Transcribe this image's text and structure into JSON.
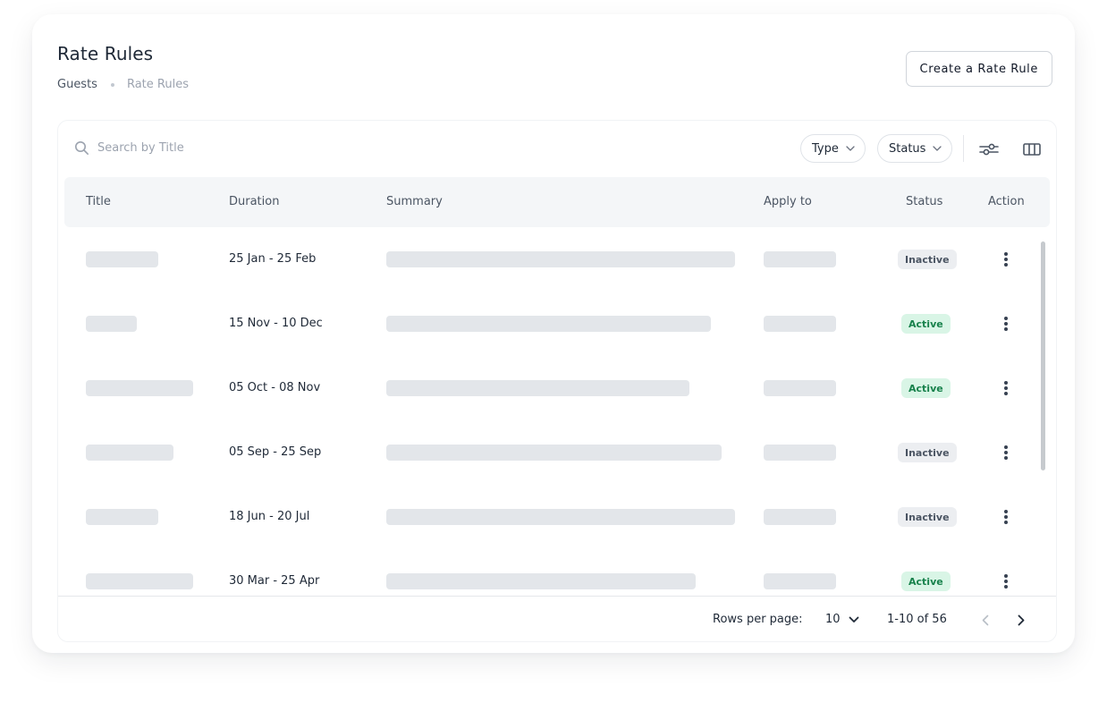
{
  "header": {
    "title": "Rate Rules",
    "breadcrumb": [
      "Guests",
      "Rate Rules"
    ],
    "create_button_label": "Create a Rate Rule"
  },
  "toolbar": {
    "search_placeholder": "Search by Title",
    "search_icon": "search-icon",
    "filters": [
      {
        "label": "Type",
        "icon": "chevron-down-icon"
      },
      {
        "label": "Status",
        "icon": "chevron-down-icon"
      }
    ],
    "tools": [
      "sliders-icon",
      "columns-icon"
    ]
  },
  "table": {
    "columns": [
      "Title",
      "Duration",
      "Summary",
      "Apply to",
      "Status",
      "Action"
    ],
    "rows": [
      {
        "duration": "25 Jan - 25 Feb",
        "status": "Inactive"
      },
      {
        "duration": "15 Nov - 10 Dec",
        "status": "Active"
      },
      {
        "duration": "05 Oct - 08 Nov",
        "status": "Active"
      },
      {
        "duration": "05 Sep - 25 Sep",
        "status": "Inactive"
      },
      {
        "duration": "18 Jun - 20 Jul",
        "status": "Inactive"
      },
      {
        "duration": "30 Mar - 25 Apr",
        "status": "Active"
      }
    ],
    "row_action_icon": "more-vertical-icon"
  },
  "footer": {
    "rows_per_page_label": "Rows per page:",
    "rows_per_page_value": "10",
    "range_text": "1-10 of 56",
    "prev_icon": "chevron-left-icon",
    "next_icon": "chevron-right-icon"
  },
  "colors": {
    "active_bg": "#d9f5e6",
    "active_text": "#18824c",
    "inactive_bg": "#eceef1",
    "inactive_text": "#4b5563",
    "skeleton": "#e3e6ea",
    "header_bg": "#f4f6f8"
  }
}
